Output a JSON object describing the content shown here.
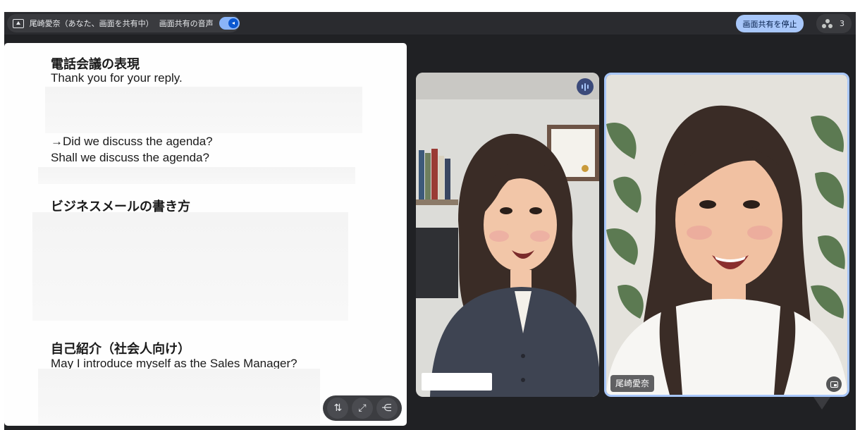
{
  "topbar": {
    "presenting_text": "尾崎愛奈（あなた、画面を共有中）",
    "audio_label": "画面共有の音声",
    "audio_icon": "speaker-icon",
    "stop_share_label": "画面共有を停止",
    "participant_count": "3",
    "participants_icon": "people-icon"
  },
  "document": {
    "section1_heading": "電話会議の表現",
    "section1_line1": "Thank you for your reply.",
    "section1_line2": "→Did we discuss the agenda?",
    "section1_line3": "Shall we discuss the agenda?",
    "section2_heading": "ビジネスメールの書き方",
    "section3_heading": "自己紹介（社会人向け）",
    "section3_line1": "May I introduce myself as the Sales Manager?"
  },
  "doc_toolbar": {
    "buttons": [
      {
        "icon": "swap-vertical-icon",
        "glyph": "⇅"
      },
      {
        "icon": "fullscreen-icon",
        "glyph": "⤢"
      },
      {
        "icon": "share-icon",
        "glyph": "⋲"
      }
    ]
  },
  "participants": [
    {
      "name": "",
      "speaking": true
    },
    {
      "name": "尾崎愛奈",
      "pinned_view": true
    }
  ],
  "colors": {
    "background": "#202124",
    "accent": "#a8c7fa",
    "button_text": "#041e49"
  }
}
